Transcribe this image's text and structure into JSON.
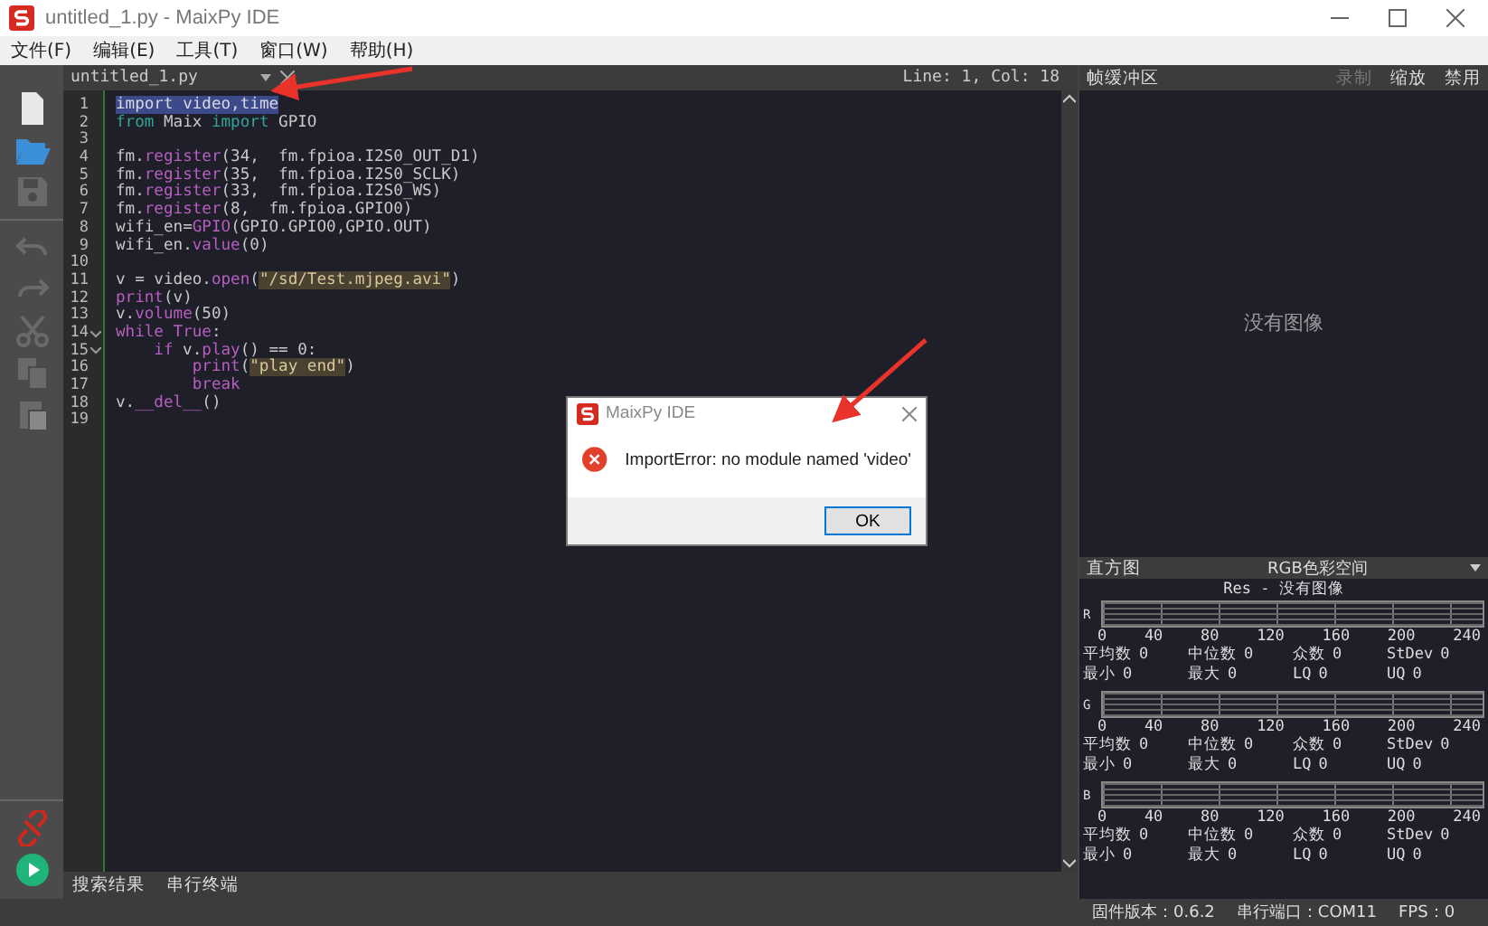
{
  "window": {
    "title": "untitled_1.py - MaixPy IDE"
  },
  "menu": [
    "文件(F)",
    "编辑(E)",
    "工具(T)",
    "窗口(W)",
    "帮助(H)"
  ],
  "toolbar": [
    {
      "kind": "new",
      "disabled": false
    },
    {
      "kind": "open",
      "disabled": false
    },
    {
      "kind": "save",
      "disabled": true
    },
    {
      "kind": "undo",
      "disabled": true
    },
    {
      "kind": "redo",
      "disabled": true
    },
    {
      "kind": "cut",
      "disabled": true
    },
    {
      "kind": "copy",
      "disabled": true
    },
    {
      "kind": "paste",
      "disabled": true
    }
  ],
  "device_buttons": [
    {
      "kind": "connect"
    },
    {
      "kind": "run"
    }
  ],
  "editor": {
    "tab": "untitled_1.py",
    "cursor": "Line: 1, Col: 18",
    "lines": [
      {
        "number": "1",
        "fold": false,
        "tokens": [
          {
            "kind": "selected",
            "text": "import video,time"
          }
        ]
      },
      {
        "number": "2",
        "fold": false,
        "tokens": [
          {
            "kind": "kw",
            "text": "from"
          },
          {
            "kind": "text",
            "text": " Maix "
          },
          {
            "kind": "kw",
            "text": "import"
          },
          {
            "kind": "text",
            "text": " GPIO"
          }
        ]
      },
      {
        "number": "3",
        "fold": false
      },
      {
        "number": "4",
        "fold": false,
        "tokens": [
          {
            "kind": "text",
            "text": "fm."
          },
          {
            "kind": "fn",
            "text": "register"
          },
          {
            "kind": "text",
            "text": "(34,  fm.fpioa.I2S0_OUT_D1)"
          }
        ]
      },
      {
        "number": "5",
        "fold": false,
        "tokens": [
          {
            "kind": "text",
            "text": "fm."
          },
          {
            "kind": "fn",
            "text": "register"
          },
          {
            "kind": "text",
            "text": "(35,  fm.fpioa.I2S0_SCLK)"
          }
        ]
      },
      {
        "number": "6",
        "fold": false,
        "tokens": [
          {
            "kind": "text",
            "text": "fm."
          },
          {
            "kind": "fn",
            "text": "register"
          },
          {
            "kind": "text",
            "text": "(33,  fm.fpioa.I2S0_WS)"
          }
        ]
      },
      {
        "number": "7",
        "fold": false,
        "tokens": [
          {
            "kind": "text",
            "text": "fm."
          },
          {
            "kind": "fn",
            "text": "register"
          },
          {
            "kind": "text",
            "text": "(8,  fm.fpioa.GPIO0)"
          }
        ]
      },
      {
        "number": "8",
        "fold": false,
        "tokens": [
          {
            "kind": "text",
            "text": "wifi_en="
          },
          {
            "kind": "fn",
            "text": "GPIO"
          },
          {
            "kind": "text",
            "text": "(GPIO.GPIO0,GPIO.OUT)"
          }
        ]
      },
      {
        "number": "9",
        "fold": false,
        "tokens": [
          {
            "kind": "text",
            "text": "wifi_en."
          },
          {
            "kind": "fn",
            "text": "value"
          },
          {
            "kind": "text",
            "text": "(0)"
          }
        ]
      },
      {
        "number": "10",
        "fold": false
      },
      {
        "number": "11",
        "fold": false,
        "tokens": [
          {
            "kind": "text",
            "text": "v = video."
          },
          {
            "kind": "fn",
            "text": "open"
          },
          {
            "kind": "text",
            "text": "("
          },
          {
            "kind": "str",
            "text": "\"/sd/Test.mjpeg.avi\""
          },
          {
            "kind": "text",
            "text": ")"
          }
        ]
      },
      {
        "number": "12",
        "fold": false,
        "tokens": [
          {
            "kind": "fn",
            "text": "print"
          },
          {
            "kind": "text",
            "text": "(v)"
          }
        ]
      },
      {
        "number": "13",
        "fold": false,
        "tokens": [
          {
            "kind": "text",
            "text": "v."
          },
          {
            "kind": "fn",
            "text": "volume"
          },
          {
            "kind": "text",
            "text": "(50)"
          }
        ]
      },
      {
        "number": "14",
        "fold": true,
        "tokens": [
          {
            "kind": "fn",
            "text": "while True"
          },
          {
            "kind": "text",
            "text": ":"
          }
        ],
        "children": [
          {
            "number": "15",
            "fold": true,
            "tokens": [
              {
                "kind": "fn",
                "text": "if"
              },
              {
                "kind": "text",
                "text": " v."
              },
              {
                "kind": "fn",
                "text": "play"
              },
              {
                "kind": "text",
                "text": "() == 0:"
              }
            ],
            "children": [
              {
                "number": "16",
                "fold": false,
                "tokens": [
                  {
                    "kind": "fn",
                    "text": "print"
                  },
                  {
                    "kind": "text",
                    "text": "("
                  },
                  {
                    "kind": "str",
                    "text": "\"play end\""
                  },
                  {
                    "kind": "text",
                    "text": ")"
                  }
                ]
              },
              {
                "number": "17",
                "fold": false,
                "tokens": [
                  {
                    "kind": "fn",
                    "text": "break"
                  }
                ]
              }
            ]
          }
        ]
      },
      {
        "number": "18",
        "fold": false,
        "tokens": [
          {
            "kind": "text",
            "text": "v."
          },
          {
            "kind": "fn",
            "text": "__del__"
          },
          {
            "kind": "text",
            "text": "()"
          }
        ]
      },
      {
        "number": "19",
        "fold": false
      }
    ]
  },
  "bottom_tabs": [
    "搜索结果",
    "串行终端"
  ],
  "framebuffer": {
    "title": "帧缓冲区",
    "buttons": [
      {
        "label": "录制",
        "disabled": true
      },
      {
        "label": "缩放",
        "disabled": false
      },
      {
        "label": "禁用",
        "disabled": false
      }
    ],
    "empty_text": "没有图像"
  },
  "histogram": {
    "title": "直方图",
    "color_space": "RGB色彩空间",
    "subtitle": "Res - 没有图像",
    "channels": [
      {
        "label": "R",
        "ticks": [
          "0",
          "40",
          "80",
          "120",
          "160",
          "200",
          "240"
        ],
        "stats": [
          [
            {
              "label": "平均数",
              "value": "0"
            },
            {
              "label": "中位数",
              "value": "0"
            },
            {
              "label": "众数",
              "value": "0"
            },
            {
              "label": "StDev",
              "value": "0"
            }
          ],
          [
            {
              "label": "最小",
              "value": "0"
            },
            {
              "label": "最大",
              "value": "0"
            },
            {
              "label": "LQ",
              "value": "0"
            },
            {
              "label": "UQ",
              "value": "0"
            }
          ]
        ]
      },
      {
        "label": "G",
        "ticks": [
          "0",
          "40",
          "80",
          "120",
          "160",
          "200",
          "240"
        ],
        "stats": [
          [
            {
              "label": "平均数",
              "value": "0"
            },
            {
              "label": "中位数",
              "value": "0"
            },
            {
              "label": "众数",
              "value": "0"
            },
            {
              "label": "StDev",
              "value": "0"
            }
          ],
          [
            {
              "label": "最小",
              "value": "0"
            },
            {
              "label": "最大",
              "value": "0"
            },
            {
              "label": "LQ",
              "value": "0"
            },
            {
              "label": "UQ",
              "value": "0"
            }
          ]
        ]
      },
      {
        "label": "B",
        "ticks": [
          "0",
          "40",
          "80",
          "120",
          "160",
          "200",
          "240"
        ],
        "stats": [
          [
            {
              "label": "平均数",
              "value": "0"
            },
            {
              "label": "中位数",
              "value": "0"
            },
            {
              "label": "众数",
              "value": "0"
            },
            {
              "label": "StDev",
              "value": "0"
            }
          ],
          [
            {
              "label": "最小",
              "value": "0"
            },
            {
              "label": "最大",
              "value": "0"
            },
            {
              "label": "LQ",
              "value": "0"
            },
            {
              "label": "UQ",
              "value": "0"
            }
          ]
        ]
      }
    ]
  },
  "status_bar": [
    "固件版本：0.6.2",
    "串行端口：COM11",
    "FPS：0"
  ],
  "dialog": {
    "title": "MaixPy IDE",
    "message": "ImportError: no module named 'video'",
    "button": "OK"
  }
}
